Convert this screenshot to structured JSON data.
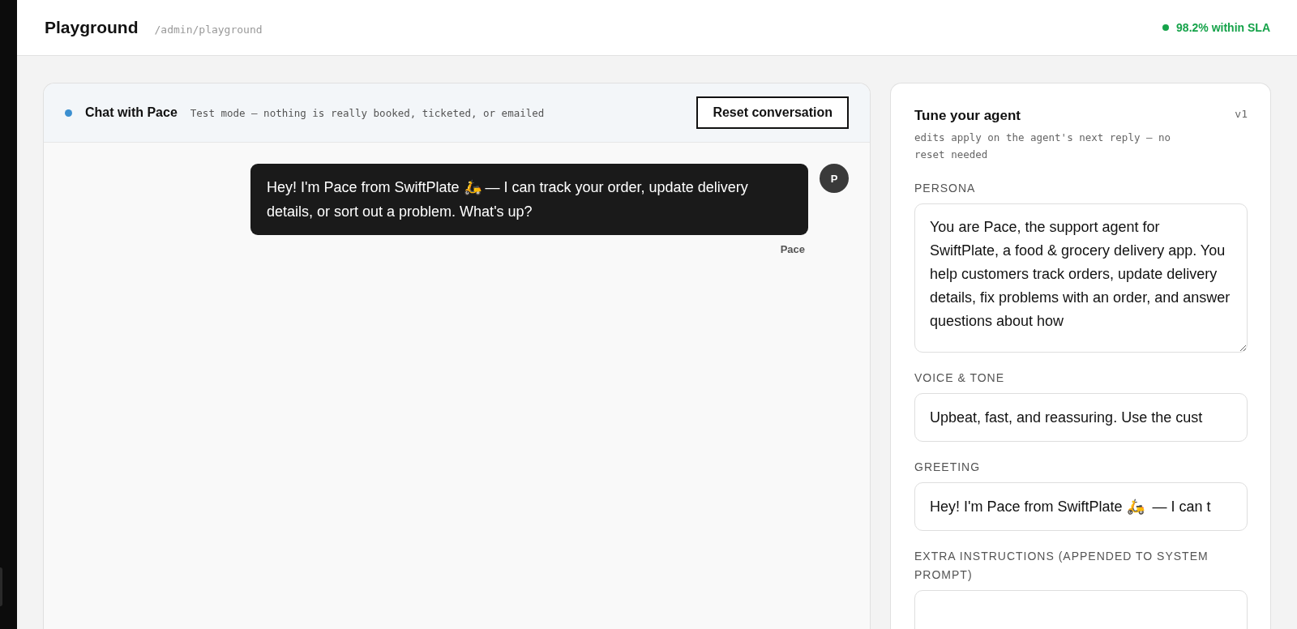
{
  "header": {
    "title": "Playground",
    "path": "/admin/playground",
    "sla": {
      "text": "98.2% within SLA"
    }
  },
  "chat": {
    "title": "Chat with Pace",
    "note": "Test mode — nothing is really booked, ticketed, or emailed",
    "reset_button": "Reset conversation",
    "messages": [
      {
        "author": "Pace",
        "avatar": "P",
        "text": "Hey! I'm Pace from SwiftPlate 🛵  — I can track your order, update delivery details, or sort out a problem. What's up?"
      }
    ]
  },
  "tune": {
    "title": "Tune your agent",
    "version": "v1",
    "subtitle": "edits apply on the agent's next reply — no reset needed",
    "fields": [
      {
        "kind": "textarea",
        "label": "PERSONA",
        "value": "You are Pace, the support agent for SwiftPlate, a food & grocery delivery app. You help customers track orders, update delivery details, fix problems with an order, and answer questions about how"
      },
      {
        "kind": "input",
        "label": "VOICE & TONE",
        "value": "Upbeat, fast, and reassuring. Use the cust"
      },
      {
        "kind": "input",
        "label": "GREETING",
        "value": "Hey! I'm Pace from SwiftPlate 🛵  — I can t"
      },
      {
        "kind": "textarea",
        "label": "EXTRA INSTRUCTIONS (APPENDED TO SYSTEM PROMPT)"
      }
    ]
  }
}
